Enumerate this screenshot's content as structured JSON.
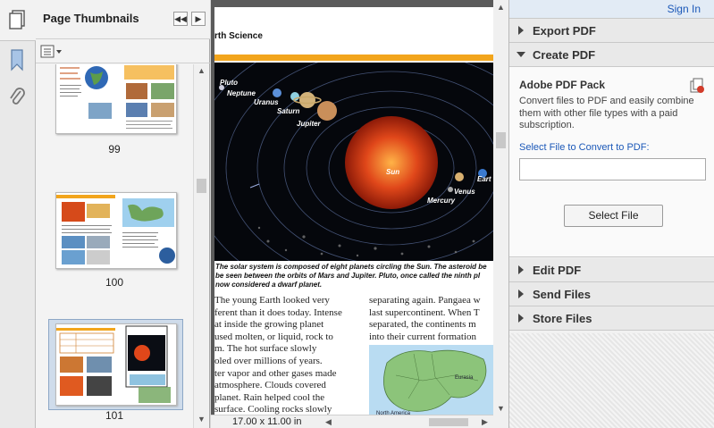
{
  "thumbnails_panel": {
    "title": "Page Thumbnails",
    "pages": [
      {
        "number": "99",
        "selected": false
      },
      {
        "number": "100",
        "selected": false
      },
      {
        "number": "101",
        "selected": true
      }
    ]
  },
  "document": {
    "header_text": "rth Science",
    "planet_labels": [
      "Pluto",
      "Neptune",
      "Uranus",
      "Saturn",
      "Jupiter",
      "Sun",
      "Venus",
      "Mercury",
      "Eart"
    ],
    "caption_lines": [
      "The solar system is composed of eight planets circling the Sun. The asteroid be",
      "be seen between the orbits of Mars and Jupiter. Pluto, once called the ninth pl",
      "now considered a dwarf planet."
    ],
    "left_column_lines": [
      "The young Earth looked very",
      "ferent than it does today. Intense",
      "at inside the growing planet",
      "used molten, or liquid, rock to",
      "m. The hot surface slowly",
      "oled over millions of years.",
      "ter vapor and other gases made",
      "atmosphere. Clouds covered",
      "planet. Rain helped cool the",
      "surface. Cooling rocks slowly"
    ],
    "right_column_lines": [
      "separating again. Pangaea w",
      "last supercontinent. When T",
      "separated, the continents m",
      "into their current formation"
    ],
    "map_labels": [
      "Eurasia",
      "North America"
    ],
    "page_size": "17.00 x 11.00 in"
  },
  "tools_pane": {
    "sign_in": "Sign In",
    "sections": {
      "export_pdf": "Export PDF",
      "create_pdf": "Create PDF",
      "edit_pdf": "Edit PDF",
      "send_files": "Send Files",
      "store_files": "Store Files"
    },
    "create_pdf_body": {
      "title": "Adobe PDF Pack",
      "description": "Convert files to PDF and easily combine them with other file types with a paid subscription.",
      "select_label": "Select File to Convert to PDF:",
      "file_value": "",
      "button_label": "Select File"
    }
  },
  "colors": {
    "link_blue": "#1b58b8",
    "orange_accent": "#f2a51c",
    "sun_orange": "#e0471a"
  }
}
